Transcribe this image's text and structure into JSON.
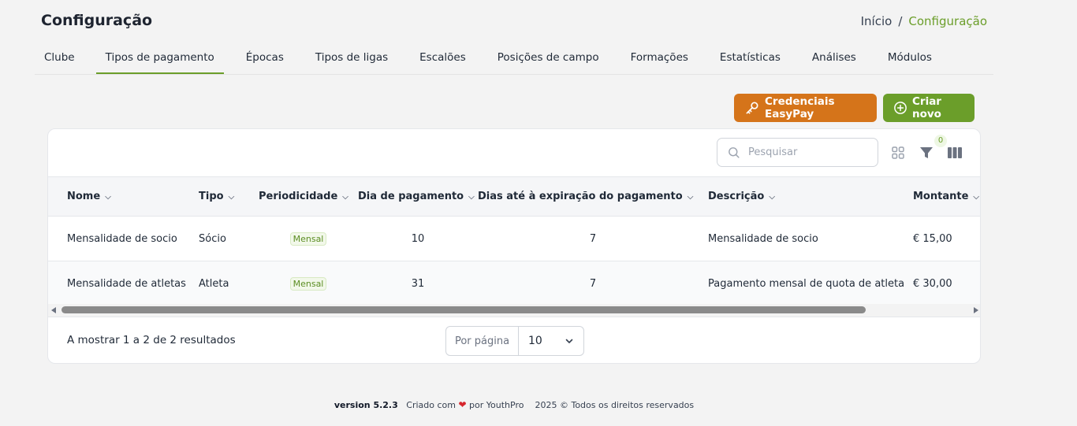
{
  "page": {
    "title": "Configuração"
  },
  "breadcrumb": {
    "home": "Início",
    "separator": "/",
    "current": "Configuração"
  },
  "tabs": [
    {
      "label": "Clube",
      "active": false
    },
    {
      "label": "Tipos de pagamento",
      "active": true
    },
    {
      "label": "Épocas",
      "active": false
    },
    {
      "label": "Tipos de ligas",
      "active": false
    },
    {
      "label": "Escalões",
      "active": false
    },
    {
      "label": "Posições de campo",
      "active": false
    },
    {
      "label": "Formações",
      "active": false
    },
    {
      "label": "Estatísticas",
      "active": false
    },
    {
      "label": "Análises",
      "active": false
    },
    {
      "label": "Módulos",
      "active": false
    }
  ],
  "actions": {
    "easypay_label": "Credenciais EasyPay",
    "create_label": "Criar novo"
  },
  "toolbar": {
    "search_placeholder": "Pesquisar",
    "filter_count": "0"
  },
  "table": {
    "columns": [
      "Nome",
      "Tipo",
      "Periodicidade",
      "Dia de pagamento",
      "Dias até à expiração do pagamento",
      "Descrição",
      "Montante"
    ],
    "rows": [
      {
        "nome": "Mensalidade de socio",
        "tipo": "Sócio",
        "periodicidade": "Mensal",
        "dia": "10",
        "dias_expiracao": "7",
        "descricao": "Mensalidade de socio",
        "montante": "€ 15,00"
      },
      {
        "nome": "Mensalidade de atletas",
        "tipo": "Atleta",
        "periodicidade": "Mensal",
        "dia": "31",
        "dias_expiracao": "7",
        "descricao": "Pagamento mensal de quota de atleta",
        "montante": "€ 30,00"
      }
    ]
  },
  "pagination": {
    "results_text": "A mostrar 1 a 2 de 2 resultados",
    "per_page_label": "Por página",
    "per_page_value": "10"
  },
  "footer": {
    "version": "version 5.2.3",
    "created_with": "Criado com",
    "by": "por YouthPro",
    "copyright": "2025 © Todos os direitos reservados"
  },
  "colors": {
    "accent_green": "#6b9e2a",
    "easypay_orange": "#d5741a",
    "heart_red": "#d6262d"
  }
}
